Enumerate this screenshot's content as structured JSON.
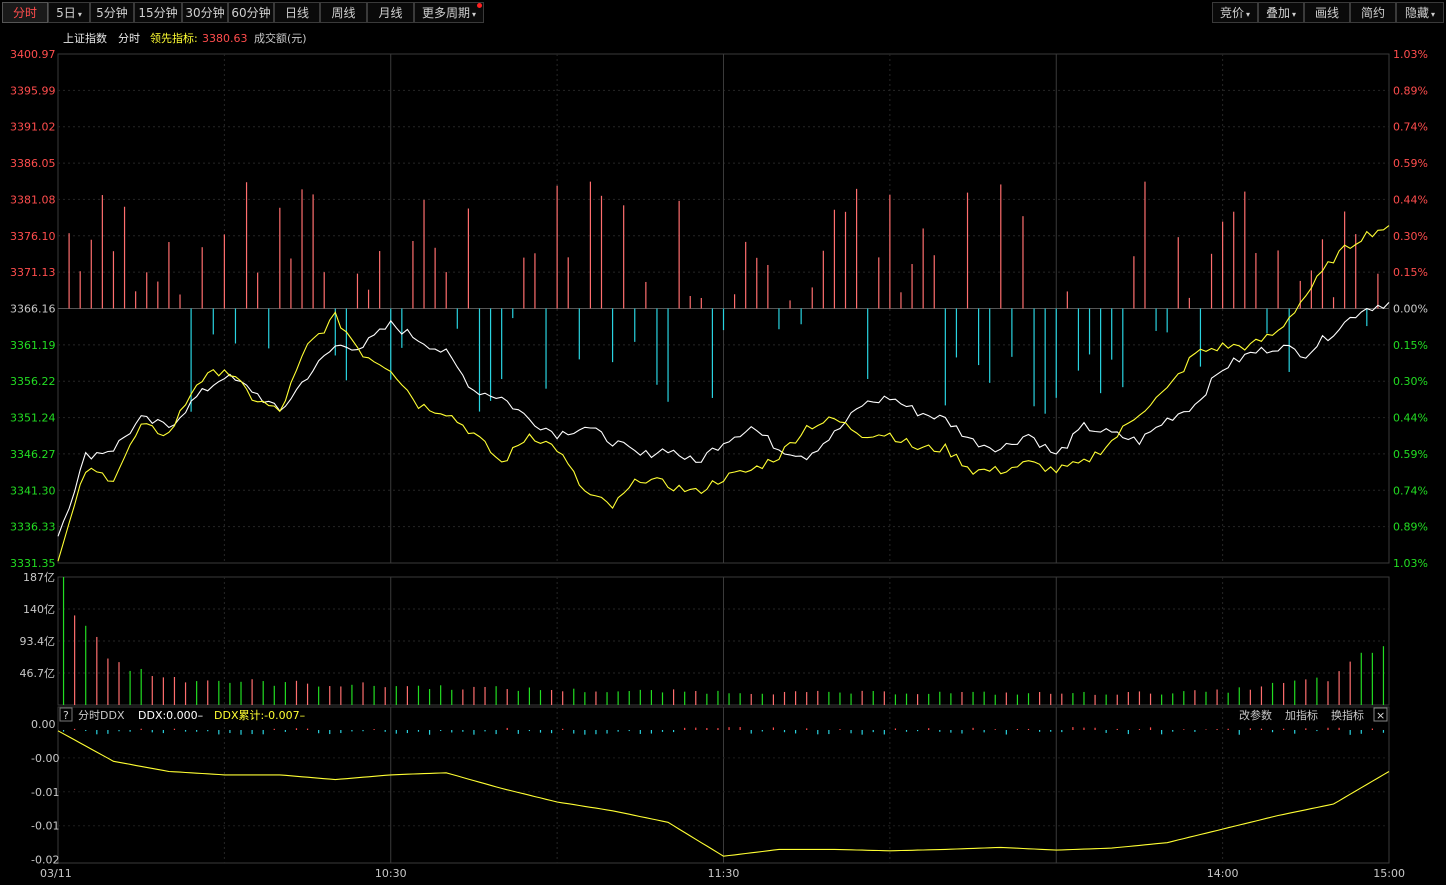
{
  "toolbar": {
    "left": [
      {
        "label": "分时",
        "active": true,
        "dropdown": false
      },
      {
        "label": "5日",
        "active": false,
        "dropdown": true
      },
      {
        "label": "5分钟",
        "active": false,
        "dropdown": false
      },
      {
        "label": "15分钟",
        "active": false,
        "dropdown": false
      },
      {
        "label": "30分钟",
        "active": false,
        "dropdown": false
      },
      {
        "label": "60分钟",
        "active": false,
        "dropdown": false
      },
      {
        "label": "日线",
        "active": false,
        "dropdown": false
      },
      {
        "label": "周线",
        "active": false,
        "dropdown": false
      },
      {
        "label": "月线",
        "active": false,
        "dropdown": false
      },
      {
        "label": "更多周期",
        "active": false,
        "dropdown": true
      }
    ],
    "right": [
      {
        "label": "竞价",
        "dropdown": true
      },
      {
        "label": "叠加",
        "dropdown": true
      },
      {
        "label": "画线",
        "dropdown": false
      },
      {
        "label": "简约",
        "dropdown": false
      },
      {
        "label": "隐藏",
        "dropdown": true
      }
    ]
  },
  "legend": {
    "index_name": "上证指数",
    "mode": "分时",
    "leading_label": "领先指标:",
    "leading_value": "3380.63",
    "volume_label": "成交额(元)"
  },
  "subpanel": {
    "help": "?",
    "name": "分时DDX",
    "ddx": "DDX:0.000–",
    "ddx_cum": "DDX累计:-0.007–",
    "actions": [
      "改参数",
      "加指标",
      "换指标"
    ],
    "close": "×"
  },
  "colors": {
    "up": "#ff4d4d",
    "down": "#22dd22",
    "price_line": "#ffffff",
    "leading_line": "#ffff33",
    "grid": "#2a2a2a",
    "cyan": "#29d3e0",
    "bar_red": "#ff6e6e"
  },
  "chart_data": {
    "type": "line",
    "date": "03/11",
    "x_ticks": [
      "03/11",
      "10:30",
      "11:30",
      "14:00",
      "15:00"
    ],
    "price": {
      "prev_close": 3366.16,
      "y_left_ticks": [
        "3400.97",
        "3395.99",
        "3391.02",
        "3386.05",
        "3381.08",
        "3376.10",
        "3371.13",
        "3366.16",
        "3361.19",
        "3356.22",
        "3351.24",
        "3346.27",
        "3341.30",
        "3336.33",
        "3331.35"
      ],
      "y_right_ticks": [
        "1.03%",
        "0.89%",
        "0.74%",
        "0.59%",
        "0.44%",
        "0.30%",
        "0.15%",
        "0.00%",
        "0.15%",
        "0.30%",
        "0.44%",
        "0.59%",
        "0.74%",
        "0.89%",
        "1.03%"
      ],
      "ylim": [
        3331.35,
        3400.97
      ],
      "series": [
        {
          "key": "price",
          "x": [
            0,
            5,
            10,
            15,
            20,
            25,
            30,
            35,
            40,
            45,
            50,
            55,
            60,
            65,
            70,
            75,
            80,
            85,
            90,
            95,
            100,
            105,
            110,
            115,
            120,
            125,
            130,
            135,
            140,
            145,
            150,
            155,
            160,
            165,
            170,
            175,
            180,
            185,
            190,
            195,
            200,
            205,
            210,
            215,
            220,
            225,
            230,
            235,
            240
          ],
          "values": [
            3335,
            3346,
            3347,
            3351,
            3350,
            3354,
            3357,
            3355,
            3352,
            3357,
            3361,
            3361,
            3364,
            3362,
            3360,
            3355,
            3354,
            3351,
            3349,
            3350,
            3348,
            3346,
            3347,
            3345,
            3348,
            3350,
            3347,
            3346,
            3349,
            3353,
            3354,
            3352,
            3351,
            3348,
            3347,
            3349,
            3346,
            3350,
            3349,
            3348,
            3351,
            3353,
            3358,
            3360,
            3361,
            3360,
            3363,
            3366,
            3367
          ]
        },
        {
          "key": "leading",
          "x": [
            0,
            5,
            10,
            15,
            20,
            25,
            30,
            35,
            40,
            45,
            50,
            55,
            60,
            65,
            70,
            75,
            80,
            85,
            90,
            95,
            100,
            105,
            110,
            115,
            120,
            125,
            130,
            135,
            140,
            145,
            150,
            155,
            160,
            165,
            170,
            175,
            180,
            185,
            190,
            195,
            200,
            205,
            210,
            215,
            220,
            225,
            230,
            235,
            240
          ],
          "values": [
            3331.6,
            3344,
            3343,
            3350,
            3349,
            3356,
            3358,
            3354,
            3352,
            3361,
            3365,
            3360,
            3358,
            3353,
            3352,
            3349,
            3345,
            3349,
            3347,
            3341,
            3339,
            3343,
            3342,
            3341,
            3343,
            3344,
            3346,
            3350,
            3351,
            3349,
            3349,
            3347,
            3347,
            3344,
            3344,
            3345,
            3344,
            3345,
            3348,
            3352,
            3355,
            3360,
            3361,
            3361,
            3363,
            3368,
            3373,
            3376,
            3377.5
          ]
        }
      ]
    },
    "volume": {
      "y_ticks": [
        "187亿",
        "140亿",
        "93.4亿",
        "46.7亿"
      ],
      "ylim": [
        0,
        187
      ],
      "x": [
        0,
        10,
        20,
        30,
        40,
        50,
        60,
        70,
        80,
        90,
        100,
        110,
        120,
        130,
        140,
        150,
        160,
        170,
        180,
        190,
        200,
        210,
        220,
        230,
        240
      ],
      "values": [
        187,
        60,
        40,
        35,
        32,
        30,
        28,
        26,
        24,
        22,
        20,
        20,
        19,
        18,
        18,
        18,
        18,
        17,
        17,
        17,
        18,
        20,
        30,
        40,
        95
      ]
    },
    "ddx": {
      "y_ticks": [
        "0.00",
        "-0.00",
        "-0.01",
        "-0.01",
        "-0.02"
      ],
      "ylim": [
        -0.0205,
        0.0
      ],
      "x": [
        0,
        10,
        20,
        30,
        40,
        50,
        60,
        70,
        80,
        90,
        100,
        110,
        120,
        130,
        140,
        150,
        160,
        170,
        180,
        190,
        200,
        210,
        220,
        230,
        240
      ],
      "cumulative": [
        -0.001,
        -0.0055,
        -0.007,
        -0.0075,
        -0.0075,
        -0.0082,
        -0.0075,
        -0.0072,
        -0.0095,
        -0.0115,
        -0.0128,
        -0.0145,
        -0.0195,
        -0.0185,
        -0.0185,
        -0.0187,
        -0.0185,
        -0.0182,
        -0.0186,
        -0.0183,
        -0.0175,
        -0.0155,
        -0.0135,
        -0.0118,
        -0.007
      ]
    }
  }
}
